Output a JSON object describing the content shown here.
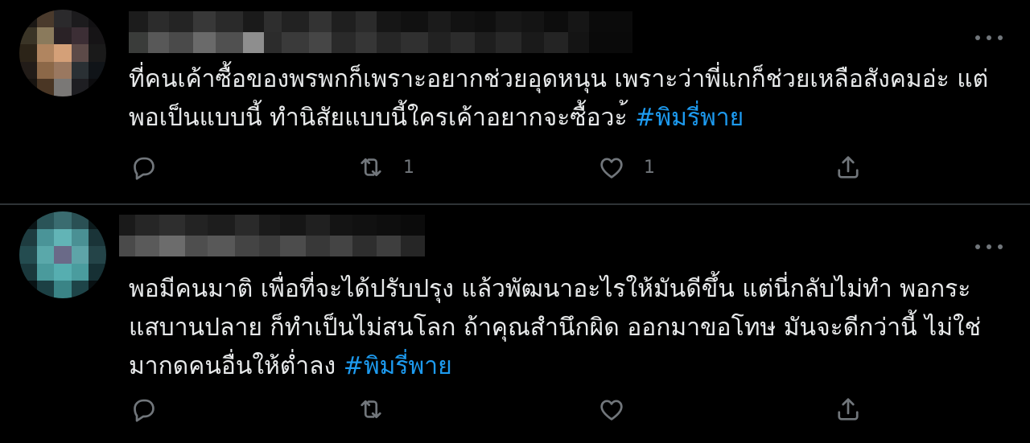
{
  "colors": {
    "background": "#000000",
    "text": "#e7e9ea",
    "muted": "#71767b",
    "hashtag": "#1d9bf0",
    "divider": "#2f3336"
  },
  "tweets": [
    {
      "text_line_1": "ที่คนเค้าซื้อของพรพกก็เพราะอยากช่วยอุดหนุน เพราะว่าพี่แกก็ช่วยเหลือสังคมอ่ะ แต่",
      "text_line_2": "พอเป็นแบบนี้ ทำนิสัยแบบนี้ใครเค้าอยากจะซื้อวะ้ ",
      "hashtag": "#พิมรี่พาย",
      "retweet_count": "1",
      "like_count": "1",
      "icons": [
        "reply-icon",
        "retweet-icon",
        "like-icon",
        "share-icon"
      ]
    },
    {
      "text_line_1": "พอมีคนมาติ เพื่อที่จะได้ปรับปรุง แล้วพัฒนาอะไรให้มันดีขึ้น แต่นี่กลับไม่ทำ พอกระ",
      "text_line_2": "แสบานปลาย ก็ทำเป็นไม่สนโลก ถ้าคุณสำนึกผิด ออกมาขอโทษ มันจะดีกว่านี้ ไม่ใช่",
      "text_line_3": "มากดคนอื่นให้ต่ำลง ",
      "hashtag": "#พิมรี่พาย",
      "icons": [
        "reply-icon",
        "retweet-icon",
        "like-icon",
        "share-icon"
      ]
    }
  ]
}
